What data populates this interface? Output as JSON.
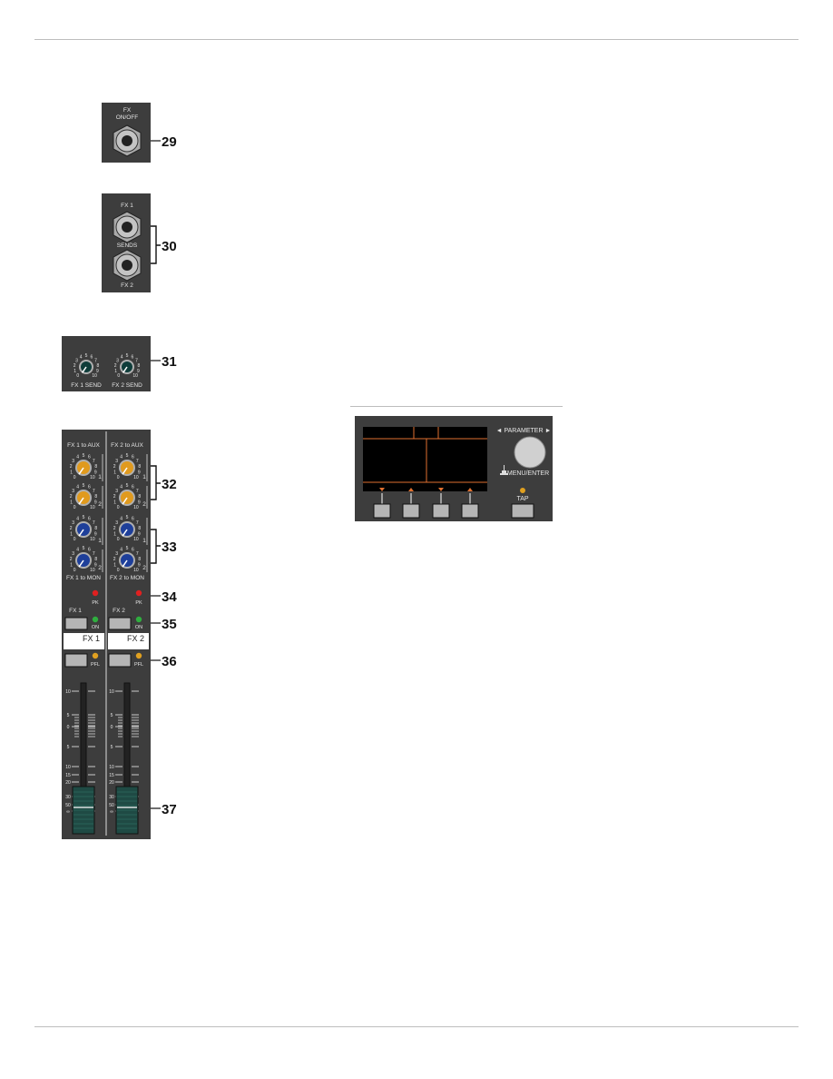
{
  "panel_29": {
    "label_top": "FX",
    "label_bottom": "ON/OFF",
    "callout": "29"
  },
  "panel_30": {
    "label_fx1": "FX 1",
    "label_sends": "SENDS",
    "label_fx2": "FX 2",
    "callout": "30"
  },
  "panel_31": {
    "knob1_label": "FX 1 SEND",
    "knob2_label": "FX 2 SEND",
    "callout": "31"
  },
  "knob_scale": [
    "0",
    "1",
    "2",
    "3",
    "4",
    "5",
    "6",
    "7",
    "8",
    "9",
    "10"
  ],
  "strip": {
    "ch1": {
      "aux_title": "FX 1 to AUX",
      "mon_title": "FX 1 to MON",
      "pk": "PK",
      "name": "FX 1",
      "on": "ON",
      "scribble": "FX 1",
      "pfl": "PFL"
    },
    "ch2": {
      "aux_title": "FX 2 to AUX",
      "mon_title": "FX 2 to MON",
      "pk": "PK",
      "name": "FX 2",
      "on": "ON",
      "scribble": "FX 2",
      "pfl": "PFL"
    },
    "aux_numbers": [
      "1",
      "2"
    ],
    "fader_scale": [
      "10",
      "5",
      "0",
      "5",
      "10",
      "15",
      "20",
      "30",
      "50",
      "∞"
    ],
    "callouts": [
      "32",
      "33",
      "34",
      "35",
      "36",
      "37"
    ]
  },
  "display_panel": {
    "parameter": "◄ PARAMETER ►",
    "menu_enter": "MENU/ENTER",
    "tap": "TAP"
  },
  "colors": {
    "panel": "#3d3d3d",
    "aux_knob": "#e09a1e",
    "mon_knob": "#1e3f9a",
    "send_knob": "#0f3d3a",
    "pk_led": "#e02020",
    "on_led": "#2fae3f",
    "pfl_led": "#e0a020",
    "display_line": "#e07030",
    "fader_cap": "#1f4a44"
  }
}
